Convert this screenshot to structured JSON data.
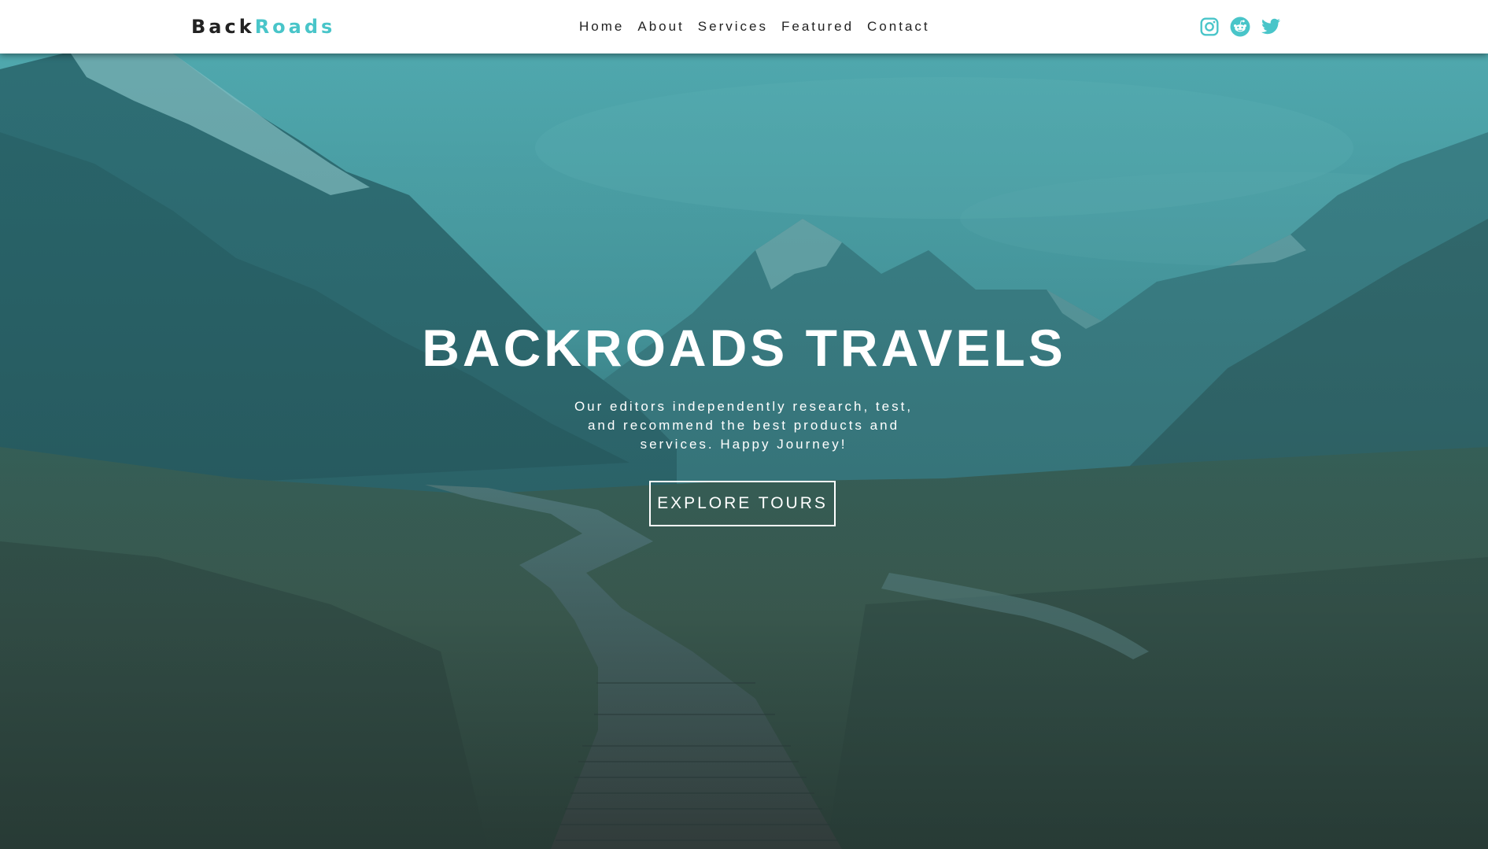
{
  "navbar": {
    "logo": {
      "part1": "Back",
      "part2": "Roads"
    },
    "links": [
      "Home",
      "About",
      "Services",
      "Featured",
      "Contact"
    ],
    "socials": [
      "instagram-icon",
      "reddit-icon",
      "twitter-icon"
    ]
  },
  "hero": {
    "title": "BACKROADS TRAVELS",
    "text": "Our editors independently research, test, and recommend the best products and services. Happy Journey!",
    "button": "EXPLORE TOURS"
  },
  "colors": {
    "brand": "#49c5c9",
    "dark": "#222222",
    "white": "#ffffff",
    "overlay": "#2a8f97"
  }
}
